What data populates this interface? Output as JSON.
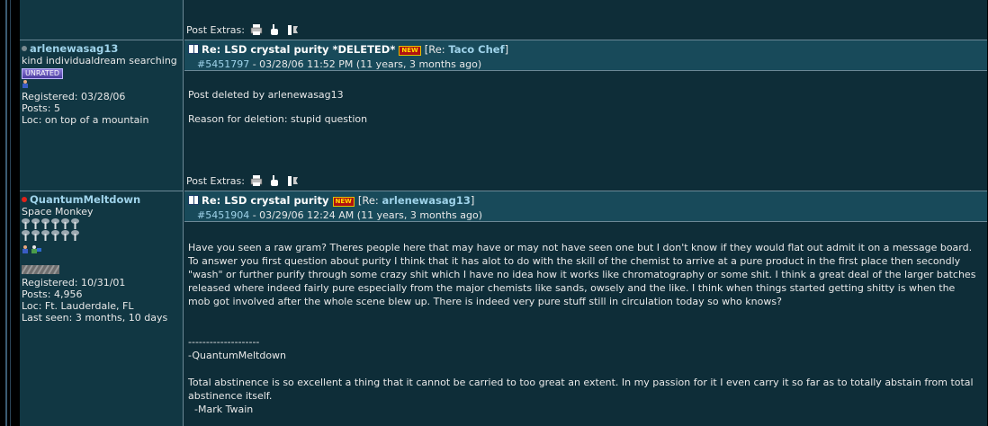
{
  "top_extras_label": "Post Extras:",
  "posts": [
    {
      "username": "arlenewasag13",
      "status_color": "#7a8a90",
      "title": "kind individualdream searching",
      "rank_badge": "UNRATED",
      "registered": "Registered: 03/28/06",
      "posts": "Posts: 5",
      "loc": "Loc: on top of a mountain",
      "subject": "Re: LSD crystal purity *DELETED*",
      "new_badge": "NEW",
      "reply_prefix": "[Re: ",
      "reply_to": "Taco Chef",
      "reply_suffix": "]",
      "post_id": "#5451797",
      "post_time": " - 03/28/06 11:52 PM (11 years, 3 months ago)",
      "body": [
        "Post deleted by arlenewasag13",
        "Reason for deletion: stupid question"
      ],
      "extras_label": "Post Extras:"
    },
    {
      "username": "QuantumMeltdown",
      "status_color": "#e0221a",
      "title": "Space Monkey",
      "registered": "Registered: 10/31/01",
      "posts": "Posts: 4,956",
      "loc": "Loc: Ft. Lauderdale, FL",
      "last_seen": "Last seen: 3 months, 10 days",
      "subject": "Re: LSD crystal purity",
      "new_badge": "NEW",
      "reply_prefix": "[Re: ",
      "reply_to": "arlenewasag13",
      "reply_suffix": "]",
      "post_id": "#5451904",
      "post_time": " - 03/29/06 12:24 AM (11 years, 3 months ago)",
      "body": [
        "Have you seen a raw gram? Theres people here that may have or may not have seen one but I don't know if they would flat out admit it on a message board. To answer you first question about purity I think that it has alot to do with the skill of the chemist to arrive at a pure product in the first place then secondly \"wash\" or further purify through some crazy shit which I have no idea how it works like chromatography or some shit. I think a great deal of the larger batches released where indeed fairly pure especially from the major chemists like sands, owsely and the like. I think when things started getting shitty is when the mob got involved after the whole scene blew up. There is indeed very pure stuff still in circulation today so who knows?"
      ],
      "sig_divider": "--------------------",
      "sig_name": "-QuantumMeltdown",
      "sig_quote": "Total abstinence is so excellent a thing that it cannot be carried to too great an extent. In my passion for it I even carry it so far as to totally abstain from total abstinence itself.",
      "sig_author": "  -Mark Twain"
    }
  ]
}
